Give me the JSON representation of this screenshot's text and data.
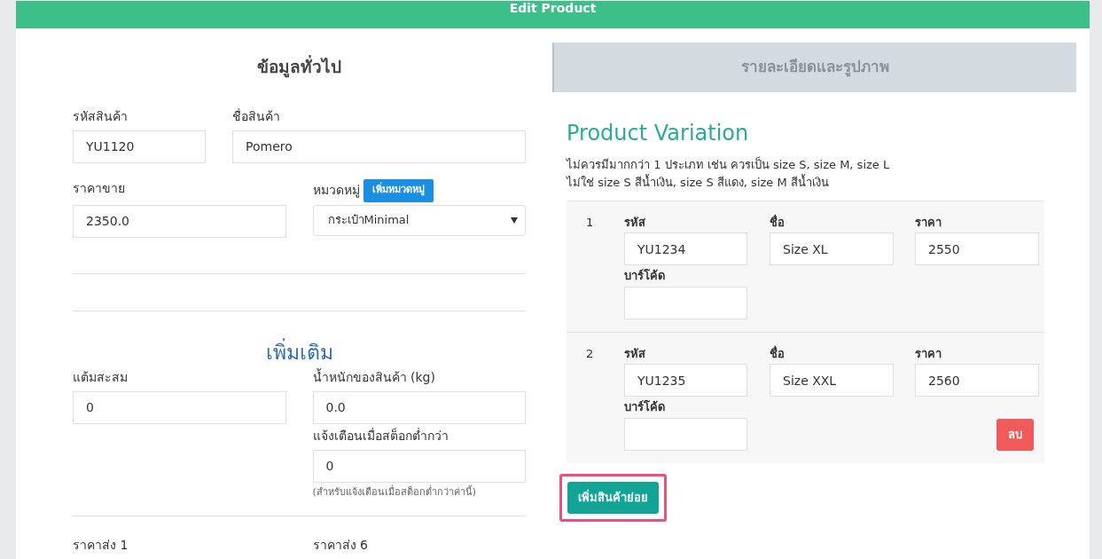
{
  "header": {
    "title": "Edit Product"
  },
  "general": {
    "title": "ข้อมูลทั่วไป",
    "code": {
      "label": "รหัสสินค้า",
      "value": "YU1120"
    },
    "name": {
      "label": "ชื่อสินค้า",
      "value": "Pomero"
    },
    "price": {
      "label": "ราคาขาย",
      "value": "2350.0"
    },
    "category": {
      "label": "หมวดหมู่",
      "add_button": "เพิ่มหมวดหมู่",
      "value": "กระเป๋าMinimal"
    }
  },
  "extra": {
    "title": "เพิ่มเติม",
    "points": {
      "label": "แต้มสะสม",
      "value": "0"
    },
    "weight": {
      "label": "น้ำหนักของสินค้า (kg)",
      "value": "0.0"
    },
    "stock_alert": {
      "label": "แจ้งเตือนเมื่อสต็อกต่ำกว่า",
      "value": "0",
      "help": "(สำหรับแจ้งเตือนเมื่อสต็อกต่ำกว่าค่านี้)"
    },
    "wholesale_labels": [
      "ราคาส่ง 1",
      "ราคาส่ง 6"
    ]
  },
  "details_tab": {
    "label": "รายละเอียดและรูปภาพ"
  },
  "variation": {
    "title": "Product Variation",
    "notes": [
      "ไม่ควรมีมากกว่า 1 ประเภท เช่น ควรเป็น size S, size M, size L",
      "ไม่ใช่ size S สีน้ำเงิน, size S สีแดง, size M สีน้ำเงิน"
    ],
    "rows": [
      {
        "number": "1",
        "code_label": "รหัส",
        "code": "YU1234",
        "name_label": "ชื่อ",
        "name": "Size XL",
        "price_label": "ราคา",
        "price": "2550",
        "barcode_label": "บาร์โค้ด",
        "delete_button": null
      },
      {
        "number": "2",
        "code_label": "รหัส",
        "code": "YU1235",
        "name_label": "ชื่อ",
        "name": "Size XXL",
        "price_label": "ราคา",
        "price": "2560",
        "barcode_label": "บาร์โค้ด",
        "delete_button": "ลบ"
      }
    ],
    "add_button": {
      "label": "เพิ่มสินค้าย่อย",
      "highlighted": true
    }
  }
}
